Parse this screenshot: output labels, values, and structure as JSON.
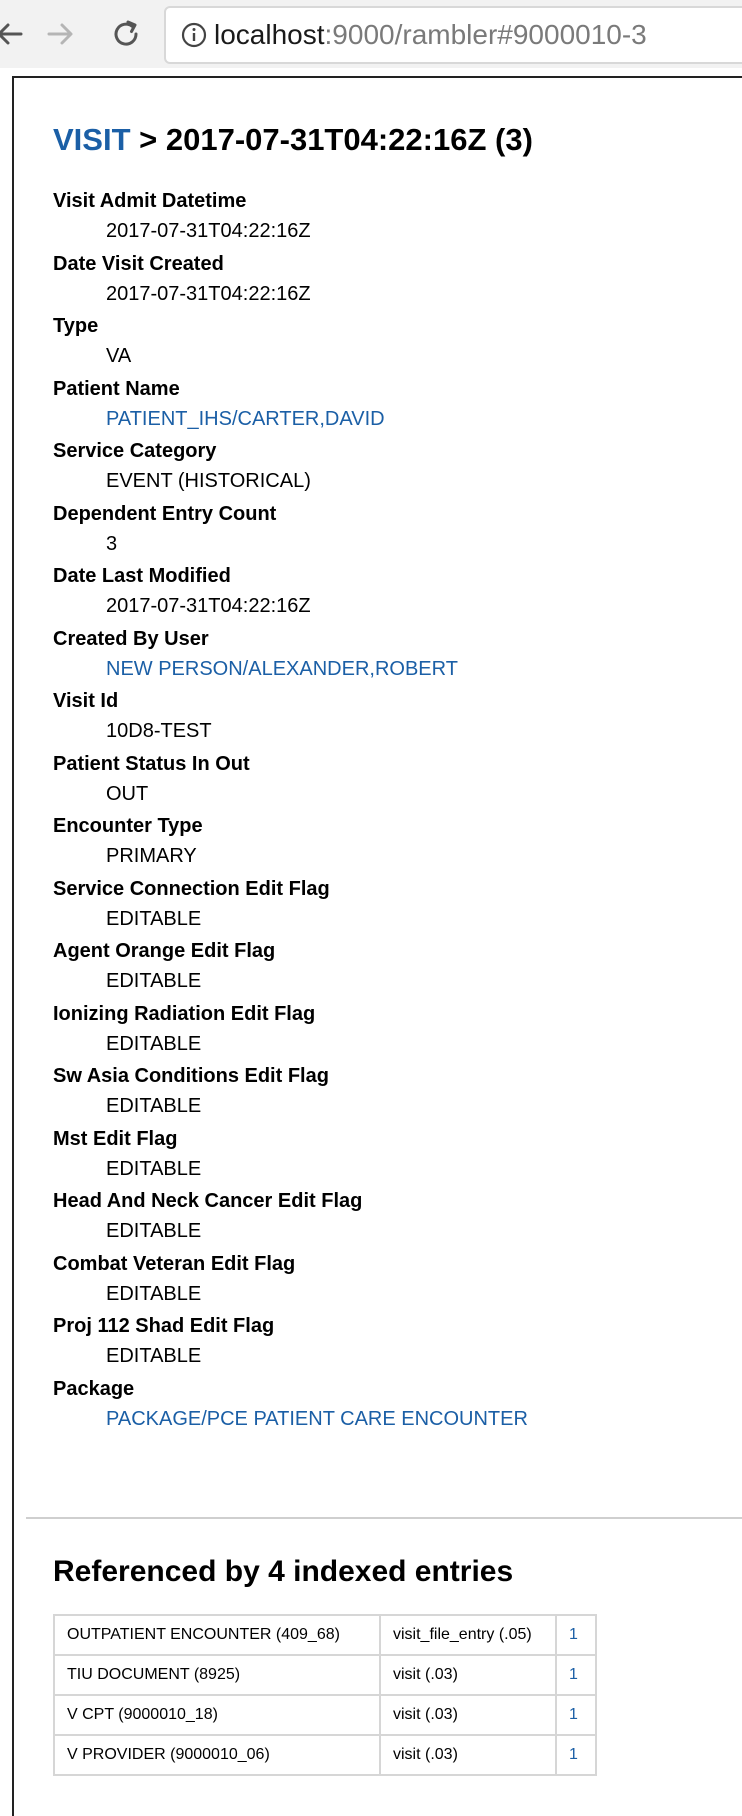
{
  "browser": {
    "url_host": "localhost",
    "url_rest": ":9000/rambler#9000010-3"
  },
  "breadcrumb": {
    "root": "VISIT",
    "separator": " > ",
    "current": "2017-07-31T04:22:16Z (3)"
  },
  "fields": [
    {
      "label": "Visit Admit Datetime",
      "value": "2017-07-31T04:22:16Z",
      "link": false
    },
    {
      "label": "Date Visit Created",
      "value": "2017-07-31T04:22:16Z",
      "link": false
    },
    {
      "label": "Type",
      "value": "VA",
      "link": false
    },
    {
      "label": "Patient Name",
      "value": "PATIENT_IHS/CARTER,DAVID",
      "link": true
    },
    {
      "label": "Service Category",
      "value": "EVENT (HISTORICAL)",
      "link": false
    },
    {
      "label": "Dependent Entry Count",
      "value": "3",
      "link": false
    },
    {
      "label": "Date Last Modified",
      "value": "2017-07-31T04:22:16Z",
      "link": false
    },
    {
      "label": "Created By User",
      "value": "NEW PERSON/ALEXANDER,ROBERT",
      "link": true
    },
    {
      "label": "Visit Id",
      "value": "10D8-TEST",
      "link": false
    },
    {
      "label": "Patient Status In Out",
      "value": "OUT",
      "link": false
    },
    {
      "label": "Encounter Type",
      "value": "PRIMARY",
      "link": false
    },
    {
      "label": "Service Connection Edit Flag",
      "value": "EDITABLE",
      "link": false
    },
    {
      "label": "Agent Orange Edit Flag",
      "value": "EDITABLE",
      "link": false
    },
    {
      "label": "Ionizing Radiation Edit Flag",
      "value": "EDITABLE",
      "link": false
    },
    {
      "label": "Sw Asia Conditions Edit Flag",
      "value": "EDITABLE",
      "link": false
    },
    {
      "label": "Mst Edit Flag",
      "value": "EDITABLE",
      "link": false
    },
    {
      "label": "Head And Neck Cancer Edit Flag",
      "value": "EDITABLE",
      "link": false
    },
    {
      "label": "Combat Veteran Edit Flag",
      "value": "EDITABLE",
      "link": false
    },
    {
      "label": "Proj 112 Shad Edit Flag",
      "value": "EDITABLE",
      "link": false
    },
    {
      "label": "Package",
      "value": "PACKAGE/PCE PATIENT CARE ENCOUNTER",
      "link": true
    }
  ],
  "references": {
    "title": "Referenced by 4 indexed entries",
    "rows": [
      {
        "file": "OUTPATIENT ENCOUNTER (409_68)",
        "field": "visit_file_entry (.05)",
        "count": "1"
      },
      {
        "file": "TIU DOCUMENT (8925)",
        "field": "visit (.03)",
        "count": "1"
      },
      {
        "file": "V CPT (9000010_18)",
        "field": "visit (.03)",
        "count": "1"
      },
      {
        "file": "V PROVIDER (9000010_06)",
        "field": "visit (.03)",
        "count": "1"
      }
    ]
  }
}
